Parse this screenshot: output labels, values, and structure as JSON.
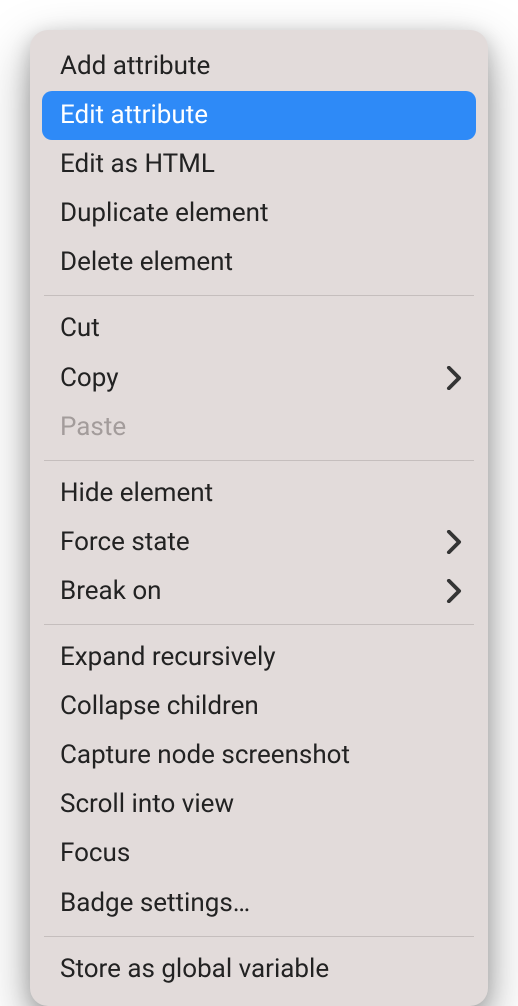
{
  "menu": {
    "groups": [
      {
        "items": [
          {
            "id": "add-attribute",
            "label": "Add attribute",
            "highlighted": false,
            "disabled": false,
            "submenu": false
          },
          {
            "id": "edit-attribute",
            "label": "Edit attribute",
            "highlighted": true,
            "disabled": false,
            "submenu": false
          },
          {
            "id": "edit-as-html",
            "label": "Edit as HTML",
            "highlighted": false,
            "disabled": false,
            "submenu": false
          },
          {
            "id": "duplicate-element",
            "label": "Duplicate element",
            "highlighted": false,
            "disabled": false,
            "submenu": false
          },
          {
            "id": "delete-element",
            "label": "Delete element",
            "highlighted": false,
            "disabled": false,
            "submenu": false
          }
        ]
      },
      {
        "items": [
          {
            "id": "cut",
            "label": "Cut",
            "highlighted": false,
            "disabled": false,
            "submenu": false
          },
          {
            "id": "copy",
            "label": "Copy",
            "highlighted": false,
            "disabled": false,
            "submenu": true
          },
          {
            "id": "paste",
            "label": "Paste",
            "highlighted": false,
            "disabled": true,
            "submenu": false
          }
        ]
      },
      {
        "items": [
          {
            "id": "hide-element",
            "label": "Hide element",
            "highlighted": false,
            "disabled": false,
            "submenu": false
          },
          {
            "id": "force-state",
            "label": "Force state",
            "highlighted": false,
            "disabled": false,
            "submenu": true
          },
          {
            "id": "break-on",
            "label": "Break on",
            "highlighted": false,
            "disabled": false,
            "submenu": true
          }
        ]
      },
      {
        "items": [
          {
            "id": "expand-recursively",
            "label": "Expand recursively",
            "highlighted": false,
            "disabled": false,
            "submenu": false
          },
          {
            "id": "collapse-children",
            "label": "Collapse children",
            "highlighted": false,
            "disabled": false,
            "submenu": false
          },
          {
            "id": "capture-node-screenshot",
            "label": "Capture node screenshot",
            "highlighted": false,
            "disabled": false,
            "submenu": false
          },
          {
            "id": "scroll-into-view",
            "label": "Scroll into view",
            "highlighted": false,
            "disabled": false,
            "submenu": false
          },
          {
            "id": "focus",
            "label": "Focus",
            "highlighted": false,
            "disabled": false,
            "submenu": false
          },
          {
            "id": "badge-settings",
            "label": "Badge settings…",
            "highlighted": false,
            "disabled": false,
            "submenu": false
          }
        ]
      },
      {
        "items": [
          {
            "id": "store-as-global-variable",
            "label": "Store as global variable",
            "highlighted": false,
            "disabled": false,
            "submenu": false
          }
        ]
      }
    ]
  }
}
